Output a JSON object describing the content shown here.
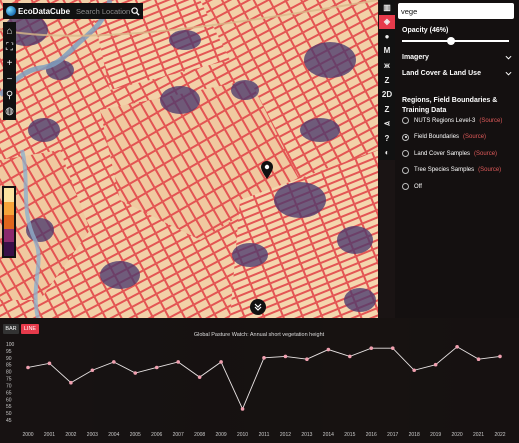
{
  "app": {
    "logo_text": "EcoDataCube",
    "search_placeholder": "Search Location"
  },
  "left_toolbar": [
    {
      "name": "home-icon",
      "glyph": "⌂"
    },
    {
      "name": "fullscreen-icon",
      "glyph": "⛶"
    },
    {
      "name": "zoom-in-icon",
      "glyph": "+"
    },
    {
      "name": "zoom-out-icon",
      "glyph": "−"
    },
    {
      "name": "location-pin-icon",
      "glyph": "⚲"
    },
    {
      "name": "globe-icon",
      "glyph": "◍"
    }
  ],
  "legend_colors": [
    "#fbe3a0",
    "#f7a53a",
    "#e0651d",
    "#8b2a6d",
    "#3a1048"
  ],
  "right_toolbar": [
    {
      "name": "map-icon",
      "glyph": "▥",
      "active": false
    },
    {
      "name": "layers-icon",
      "glyph": "◈",
      "active": true
    },
    {
      "name": "github-icon",
      "glyph": "●",
      "active": false
    },
    {
      "name": "mastodon-icon",
      "glyph": "M",
      "active": false
    },
    {
      "name": "butterfly-icon",
      "glyph": "ж",
      "active": false
    },
    {
      "name": "zenodo-icon",
      "glyph": "Z",
      "active": false
    },
    {
      "name": "2d-icon",
      "glyph": "2D",
      "active": false
    },
    {
      "name": "z-icon",
      "glyph": "Z",
      "active": false
    },
    {
      "name": "share-icon",
      "glyph": "⋖",
      "active": false
    },
    {
      "name": "help-icon",
      "glyph": "?",
      "active": false
    },
    {
      "name": "contrast-icon",
      "glyph": "◐",
      "active": false
    }
  ],
  "panel": {
    "filter_value": "vege",
    "opacity_label": "Opacity (46%)",
    "opacity_value": 0.46,
    "sections": [
      "Imagery",
      "Land Cover & Land Use"
    ],
    "subhead": "Regions, Field Boundaries & Training Data",
    "radios": [
      {
        "label": "NUTS Regions Level-3",
        "source": "(Source)",
        "checked": false
      },
      {
        "label": "Field Boundaries",
        "source": "(Source)",
        "checked": true
      },
      {
        "label": "Land Cover Samples",
        "source": "(Source)",
        "checked": false
      },
      {
        "label": "Tree Species Samples",
        "source": "(Source)",
        "checked": false
      },
      {
        "label": "Off",
        "source": "",
        "checked": false
      }
    ]
  },
  "chart_buttons": {
    "bar": "BAR",
    "line": "LINE"
  },
  "chart_data": {
    "type": "line",
    "title": "Global Pasture Watch: Annual short vegetation height",
    "x": [
      "2000",
      "2001",
      "2002",
      "2003",
      "2004",
      "2005",
      "2006",
      "2007",
      "2008",
      "2009",
      "2010",
      "2011",
      "2012",
      "2013",
      "2014",
      "2015",
      "2016",
      "2017",
      "2018",
      "2019",
      "2020",
      "2021",
      "2022"
    ],
    "values": [
      83,
      86,
      72,
      81,
      87,
      79,
      83,
      87,
      76,
      87,
      53,
      90,
      91,
      89,
      96,
      91,
      97,
      97,
      81,
      85,
      98,
      89,
      91
    ],
    "ylim": [
      45,
      100
    ],
    "yticks": [
      45,
      50,
      55,
      60,
      65,
      70,
      75,
      80,
      85,
      90,
      95,
      100
    ],
    "grid": false
  }
}
